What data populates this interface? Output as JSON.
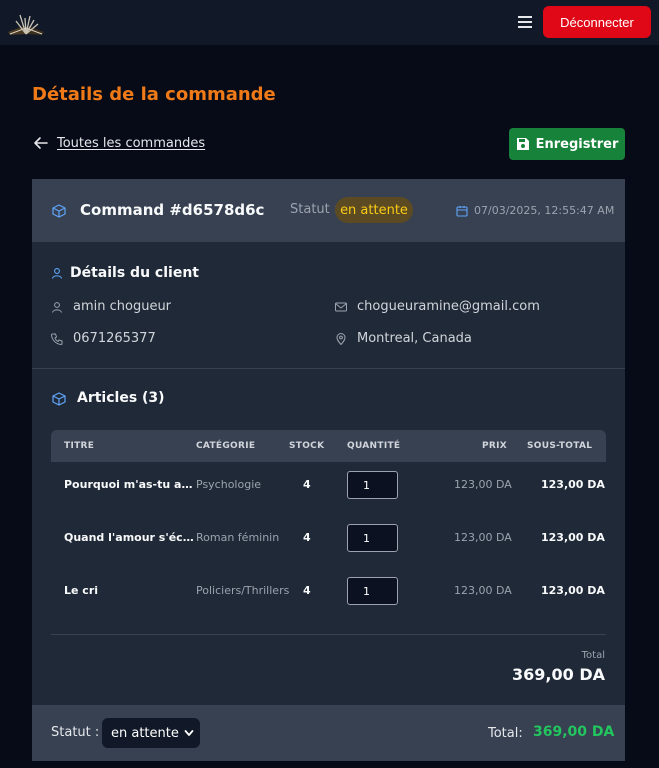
{
  "header": {
    "logo_icon": "open-book-logo",
    "menu_icon": "hamburger-icon",
    "logout_label": "Déconnecter"
  },
  "page": {
    "title": "Détails de la commande",
    "back_label": "Toutes les commandes",
    "save_label": "Enregistrer"
  },
  "order": {
    "title": "Command #d6578d6c",
    "status_label": "Statut :",
    "status_value": "en attente",
    "date": "07/03/2025, 12:55:47 AM"
  },
  "client": {
    "section_title": "Détails du client",
    "name": "amin chogueur",
    "email": "chogueuramine@gmail.com",
    "phone": "0671265377",
    "location": "Montreal, Canada"
  },
  "articles": {
    "section_title": "Articles (3)",
    "columns": [
      "TITRE",
      "CATÉGORIE",
      "STOCK",
      "QUANTITÉ",
      "PRIX",
      "SOUS-TOTAL"
    ],
    "rows": [
      {
        "title": "Pourquoi m'as-tu abandonné",
        "category": "Psychologie",
        "stock": "4",
        "quantity": "1",
        "price": "123,00 DA",
        "subtotal": "123,00 DA"
      },
      {
        "title": "Quand l'amour s'écrit en silence",
        "category": "Roman féminin",
        "stock": "4",
        "quantity": "1",
        "price": "123,00 DA",
        "subtotal": "123,00 DA"
      },
      {
        "title": "Le cri",
        "category": "Policiers/Thrillers",
        "stock": "4",
        "quantity": "1",
        "price": "123,00 DA",
        "subtotal": "123,00 DA"
      }
    ],
    "total_label": "Total",
    "total_value": "369,00 DA"
  },
  "footer": {
    "status_label": "Statut :",
    "status_selected": "en attente",
    "total_label": "Total:",
    "total_value": "369,00 DA"
  },
  "colors": {
    "accent_orange": "#f07a17",
    "logout_red": "#e00717",
    "save_green": "#16823a",
    "total_green": "#22c55e",
    "status_yellow": "#facc15"
  }
}
